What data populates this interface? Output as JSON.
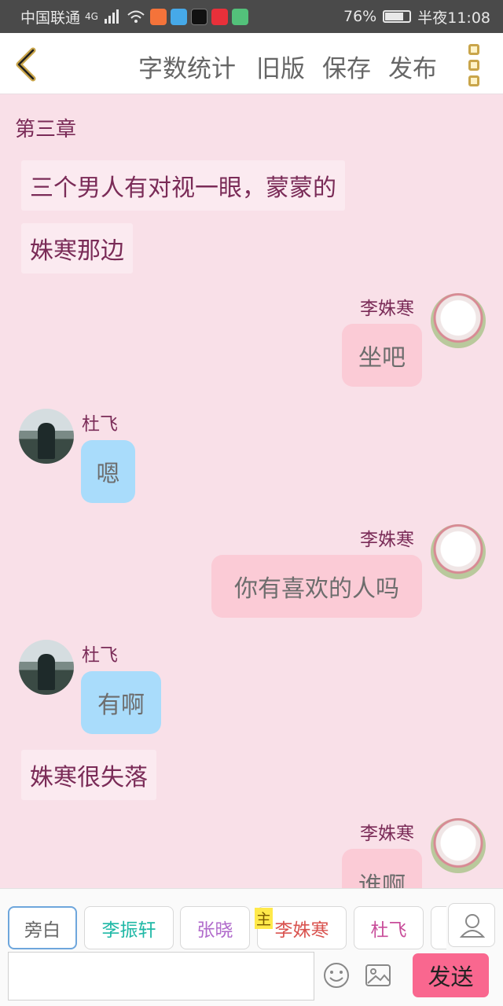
{
  "status_bar": {
    "carrier": "中国联通",
    "network": "4G",
    "battery": "76%",
    "battery_level": 0.76,
    "time": "半夜11:08"
  },
  "toolbar": {
    "word_count": "字数统计",
    "old_version": "旧版",
    "save": "保存",
    "publish": "发布"
  },
  "chat": {
    "chapter": "第三章",
    "narration_1": "三个男人有对视一眼，蒙蒙的",
    "narration_2": "姝寒那边",
    "msg1": {
      "name": "李姝寒",
      "text": "坐吧"
    },
    "msg2": {
      "name": "杜飞",
      "text": "嗯"
    },
    "msg3": {
      "name": "李姝寒",
      "text": "你有喜欢的人吗"
    },
    "msg4": {
      "name": "杜飞",
      "text": "有啊"
    },
    "narration_3": "姝寒很失落",
    "msg5": {
      "name": "李姝寒",
      "text": "谁啊"
    }
  },
  "roles": [
    {
      "label": "旁白",
      "color": "#666666"
    },
    {
      "label": "李振轩",
      "color": "#1fb8a6"
    },
    {
      "label": "张晓",
      "color": "#b06acb"
    },
    {
      "label": "李姝寒",
      "color": "#d9534f"
    },
    {
      "label": "杜飞",
      "color": "#c84d9a"
    }
  ],
  "main_badge": "主",
  "input": {
    "value": "",
    "placeholder": ""
  },
  "send_label": "发送",
  "colors": {
    "background": "#f9e0e8",
    "pink_bubble": "#fbcbd6",
    "blue_bubble": "#a9dcfb",
    "send": "#f9678f"
  }
}
